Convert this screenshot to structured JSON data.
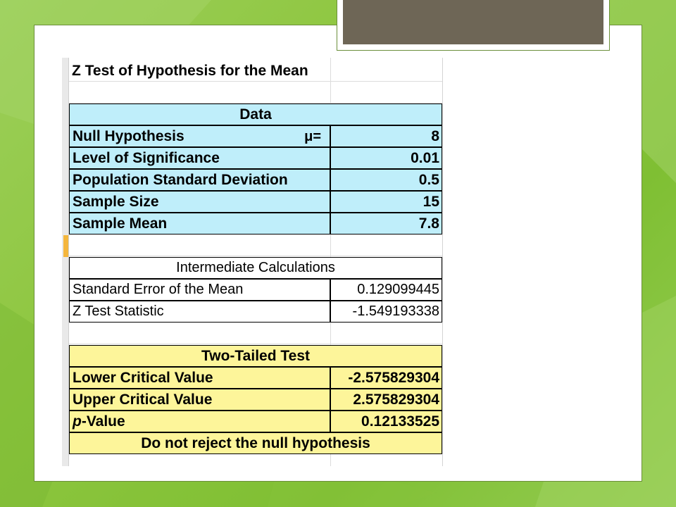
{
  "colors": {
    "background_green": "#8ec63f",
    "data_fill": "#bfeefa",
    "test_fill": "#fdf59a",
    "title_bar": "#6e6656",
    "active_cell": "#f4b63d"
  },
  "sheet": {
    "title": "Z Test of Hypothesis for the Mean",
    "data_section": {
      "header": "Data",
      "rows": [
        {
          "label": "Null Hypothesis",
          "symbol": "μ=",
          "value": "8"
        },
        {
          "label": "Level of Significance",
          "value": "0.01"
        },
        {
          "label": "Population Standard Deviation",
          "value": "0.5"
        },
        {
          "label": "Sample Size",
          "value": "15"
        },
        {
          "label": "Sample Mean",
          "value": "7.8"
        }
      ]
    },
    "intermediate_section": {
      "header": "Intermediate Calculations",
      "rows": [
        {
          "label": "Standard Error of the Mean",
          "value": "0.129099445"
        },
        {
          "label": "Z Test Statistic",
          "value": "-1.549193338"
        }
      ]
    },
    "test_section": {
      "header": "Two-Tailed Test",
      "rows": [
        {
          "label": "Lower Critical Value",
          "value": "-2.575829304"
        },
        {
          "label": "Upper Critical Value",
          "value": "2.575829304"
        },
        {
          "label_italic": "p",
          "label_rest": "-Value",
          "value": "0.12133525"
        }
      ],
      "conclusion": "Do not reject the null hypothesis"
    }
  }
}
